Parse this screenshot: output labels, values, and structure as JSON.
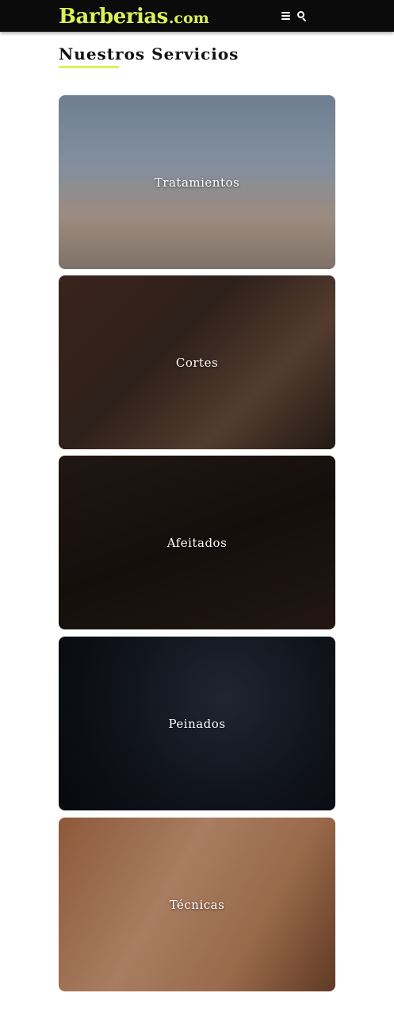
{
  "header": {
    "logo_main": "Barberias",
    "logo_tld": ".com",
    "menu_icon": "hamburger-menu-icon",
    "search_icon": "search-icon",
    "accent_color": "#d7f25a",
    "bar_color": "#0b0b0b"
  },
  "section": {
    "title": "Nuestros Servicios"
  },
  "services": [
    {
      "label": "Tratamientos"
    },
    {
      "label": "Cortes"
    },
    {
      "label": "Afeitados"
    },
    {
      "label": "Peinados"
    },
    {
      "label": "Técnicas"
    }
  ]
}
